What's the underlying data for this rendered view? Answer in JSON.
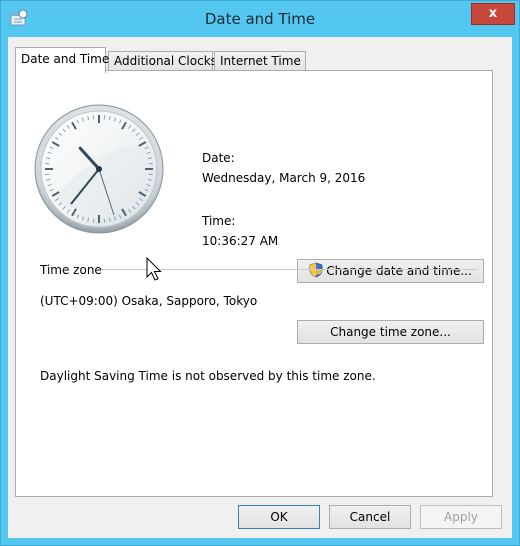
{
  "window": {
    "title": "Date and Time",
    "close_glyph": "x"
  },
  "tabs": [
    {
      "label": "Date and Time",
      "active": true
    },
    {
      "label": "Additional Clocks",
      "active": false
    },
    {
      "label": "Internet Time",
      "active": false
    }
  ],
  "date_time": {
    "date_label": "Date:",
    "date_value": "Wednesday, March 9, 2016",
    "time_label": "Time:",
    "time_value": "10:36:27 AM",
    "change_button": "Change date and time..."
  },
  "clock": {
    "hour": 10,
    "minute": 36,
    "second": 27
  },
  "time_zone": {
    "group_label": "Time zone",
    "value": "(UTC+09:00) Osaka, Sapporo, Tokyo",
    "change_button": "Change time zone...",
    "dst_note": "Daylight Saving Time is not observed by this time zone."
  },
  "footer": {
    "ok": "OK",
    "cancel": "Cancel",
    "apply": "Apply"
  },
  "colors": {
    "title_bar": "#54c7f0",
    "close_button": "#c7473a",
    "panel": "#ffffff"
  }
}
